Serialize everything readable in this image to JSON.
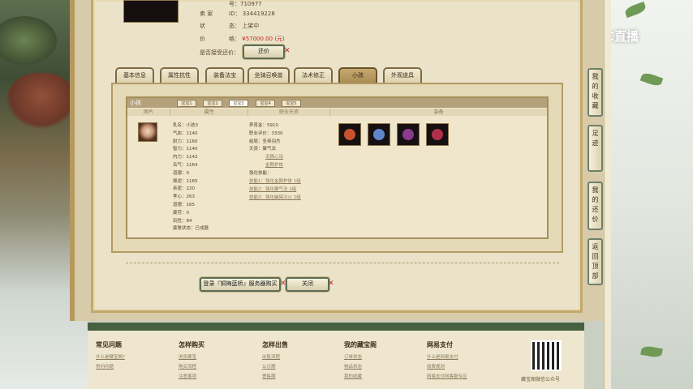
{
  "listing": {
    "pet_id_partial_label": "号：",
    "pet_id_partial_value": "710977",
    "seller_label": "卖  家",
    "seller_id_label": "ID：",
    "seller_id": "334419228",
    "status_label": "状",
    "status_colon": "态：",
    "status_value": "上架中",
    "price_label": "价",
    "price_colon": "格：",
    "price_value": "¥57000.00 (元)",
    "counter_offer_label": "是否接受还价：",
    "counter_offer_button": "还价"
  },
  "tabs": [
    "基本信息",
    "属性抗性",
    "装备法宝",
    "坐骑召唤兽",
    "法术修正",
    "小孩",
    "外观道具"
  ],
  "active_tab": "小孩",
  "child_panel": {
    "title": "小孩",
    "subtabs": [
      "宝宝1",
      "宝宝2",
      "宝宝3",
      "宝宝4",
      "宝宝5"
    ],
    "active_subtab": "宝宝3",
    "col_headers": [
      "图片",
      "属性",
      "职业天资",
      "装备"
    ],
    "attributes": [
      {
        "label": "乳名：",
        "value": "小孩3"
      },
      {
        "label": "气血：",
        "value": "1140"
      },
      {
        "label": "耐力：",
        "value": "1160"
      },
      {
        "label": "智力：",
        "value": "1140"
      },
      {
        "label": "内力：",
        "value": "1142"
      },
      {
        "label": "名气：",
        "value": "1164"
      },
      {
        "label": "道德：",
        "value": "0"
      },
      {
        "label": "叛逆：",
        "value": "1165"
      },
      {
        "label": "亲密：",
        "value": "220"
      },
      {
        "label": "孝心：",
        "value": "263"
      },
      {
        "label": "道德：",
        "value": "165"
      },
      {
        "label": "疲劳：",
        "value": "0"
      },
      {
        "label": "玩性：",
        "value": "84"
      },
      {
        "label": "疲惫状态：",
        "value": "已成器"
      }
    ],
    "career": [
      {
        "label": "养育金：",
        "value": "5910"
      },
      {
        "label": "职业评价：",
        "value": "3330"
      },
      {
        "label": "结局：",
        "value": "圣帝羽杰"
      },
      {
        "label": "天资：",
        "value": "聚气法"
      }
    ],
    "career_links": [
      "无情心法",
      "金刚护体"
    ],
    "enhance_label": "强化技能：",
    "enhance_links": [
      "技能1：强化金刚护体 1级",
      "技能2：强化聚气法 2级",
      "技能3：强化幽冥冷火 2级"
    ],
    "equipment": [
      {
        "name": "equip-item-1",
        "color": "#c8532b"
      },
      {
        "name": "equip-item-2",
        "color": "#5f86c8"
      },
      {
        "name": "equip-item-3",
        "color": "#8b3b8e"
      },
      {
        "name": "equip-item-4",
        "color": "#b0304a"
      }
    ]
  },
  "actions": {
    "login_buy": "登录『铜梅蓝桥』服务器购买",
    "close": "关闭"
  },
  "side_nav": [
    "我的收藏",
    "足迹",
    "我的还价",
    "返回顶部"
  ],
  "brand": {
    "logo_text": "CC直播"
  },
  "footer": {
    "columns": [
      {
        "title": "常见问题",
        "links": [
          "什么是藏宝阁?",
          "常问问题"
        ]
      },
      {
        "title": "怎样购买",
        "links": [
          "浏览藏宝",
          "购买流程",
          "注意事项"
        ]
      },
      {
        "title": "怎样出售",
        "links": [
          "出售流程",
          "公示期",
          "寄售期"
        ]
      },
      {
        "title": "我的藏宝阁",
        "links": [
          "订单状态",
          "物品状态",
          "我的收藏"
        ]
      },
      {
        "title": "网易支付",
        "links": [
          "什么是网易支付",
          "收费规则",
          "网易支付网客服专区"
        ]
      }
    ],
    "qr_caption": "藏宝阁微信公众号"
  }
}
